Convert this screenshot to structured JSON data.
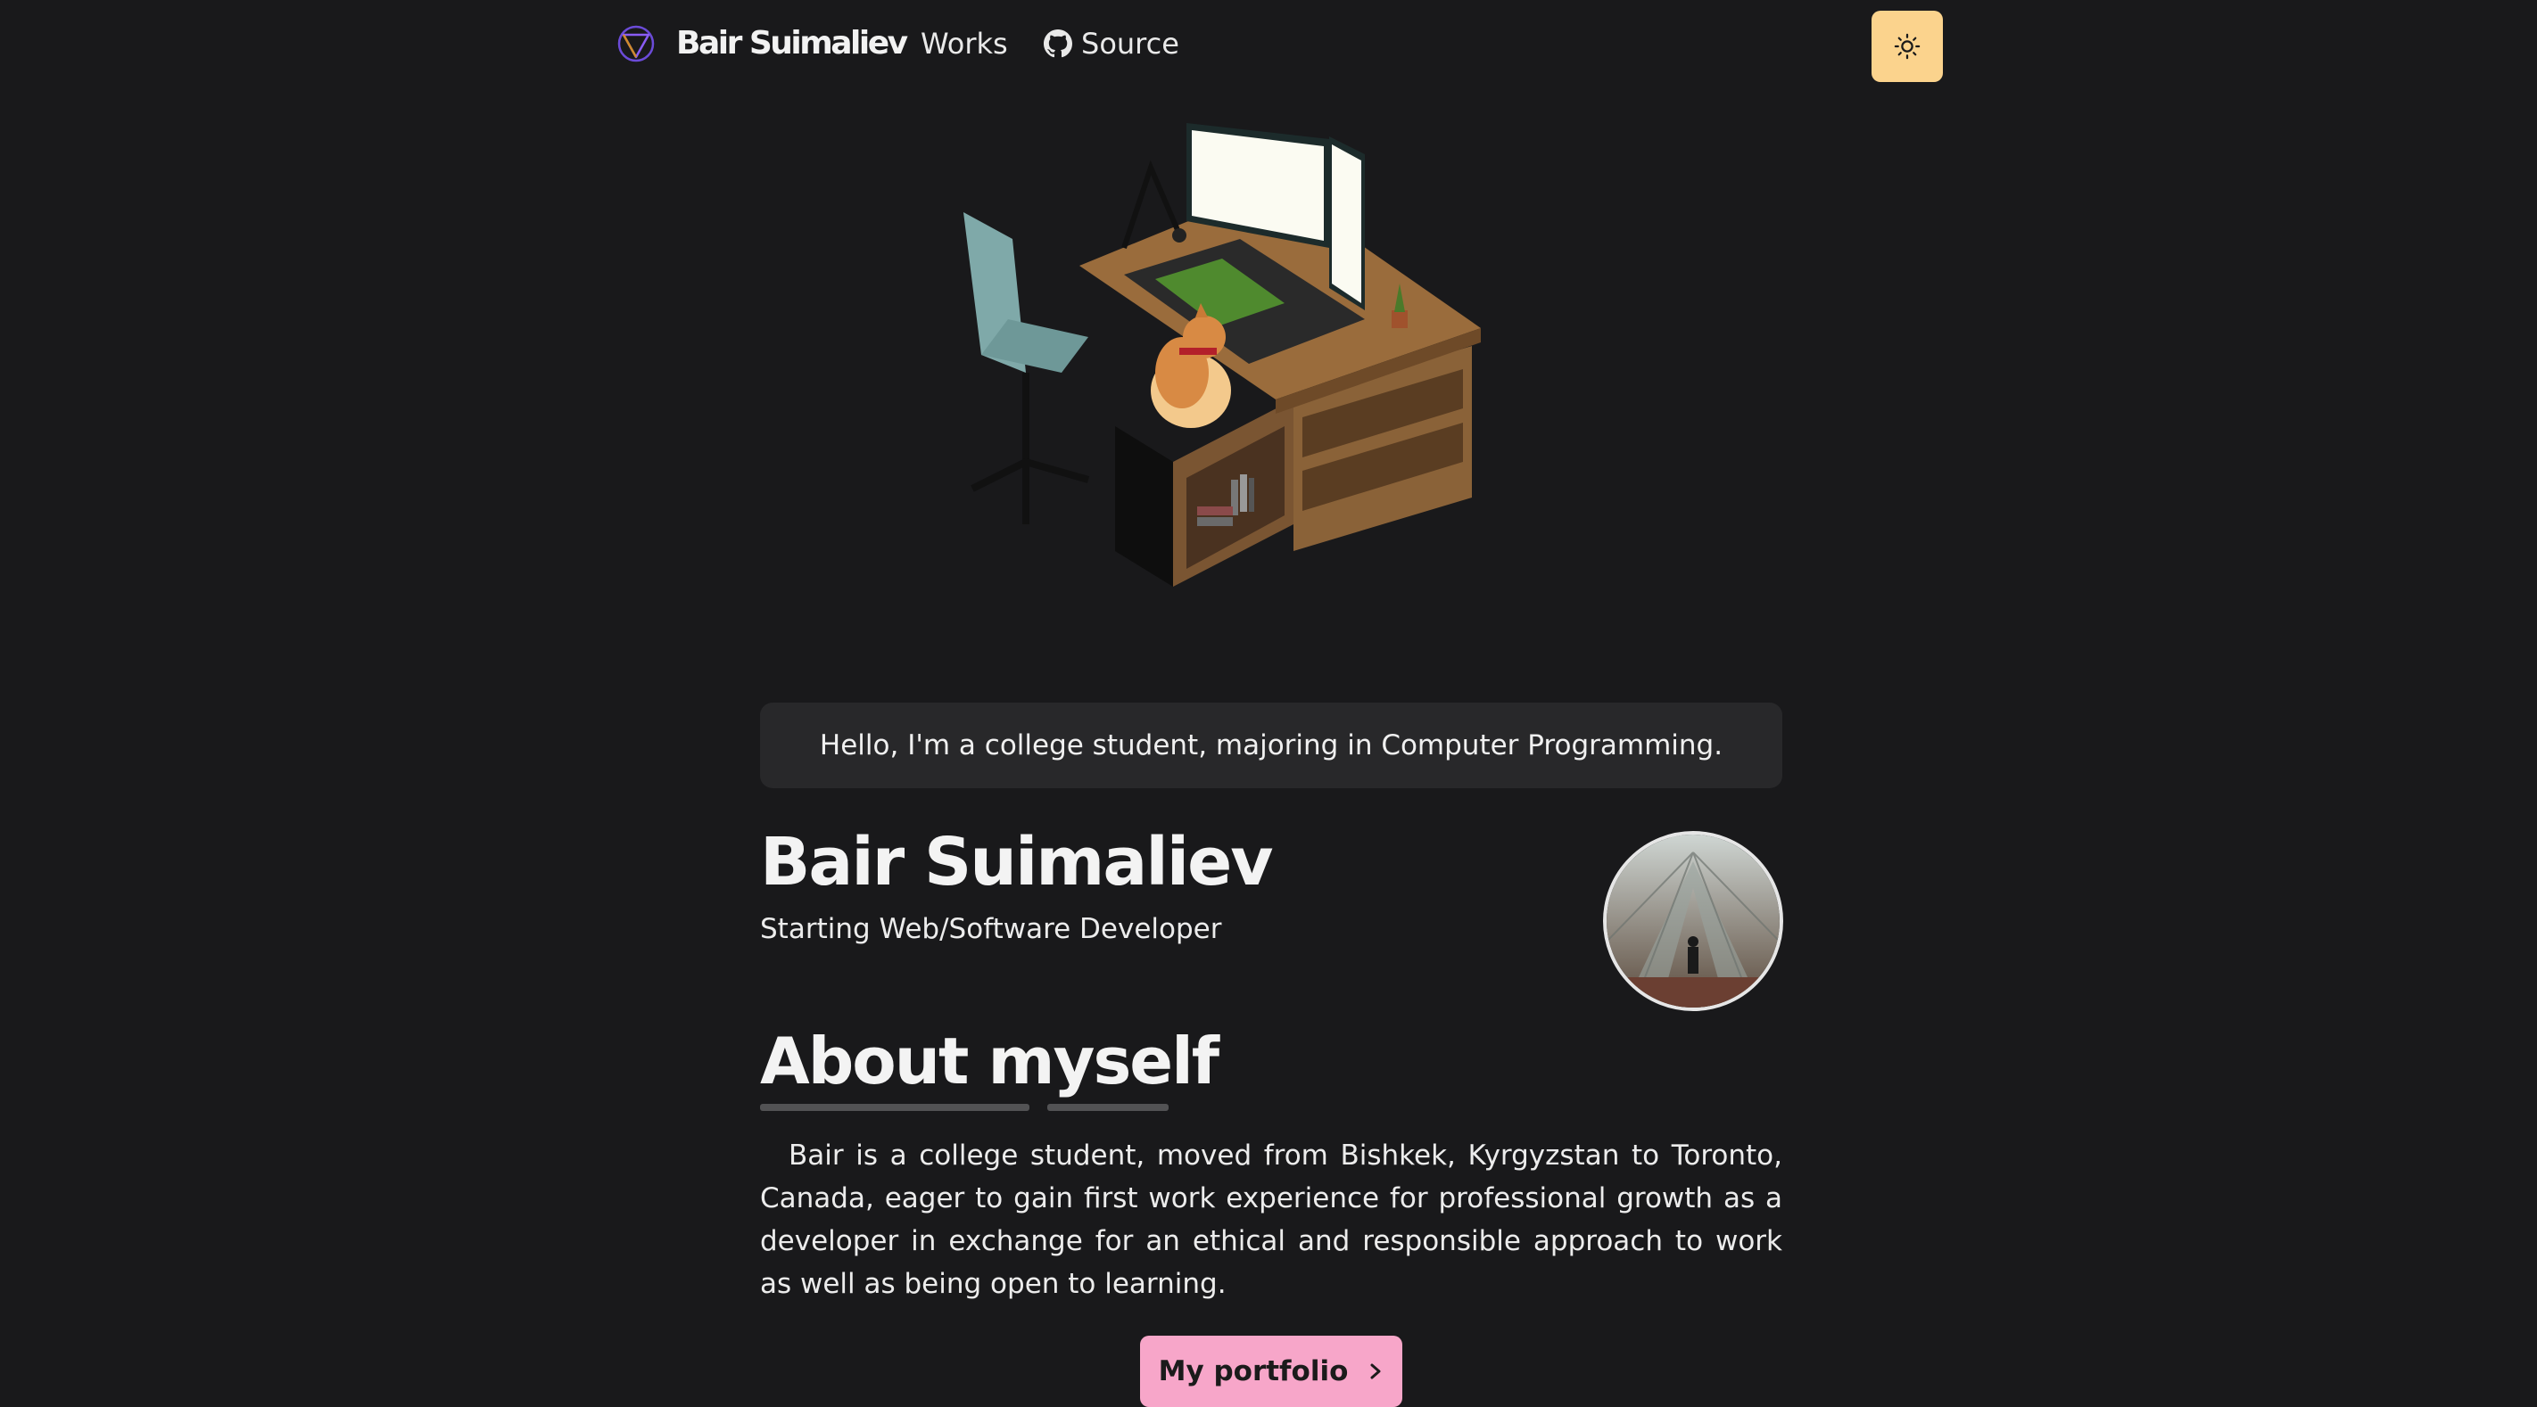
{
  "nav": {
    "brand": "Bair Suimaliev",
    "links": [
      {
        "label": "Works"
      },
      {
        "label": "Source",
        "icon": "github-icon"
      }
    ],
    "theme_toggle_icon": "sun-icon",
    "theme_toggle_color": "#fbd38d"
  },
  "hero": {
    "illustration": "3d-desk-room-with-dog-icon"
  },
  "greeting": "Hello, I'm a college student, majoring in Computer Programming.",
  "profile": {
    "name": "Bair Suimaliev",
    "role": "Starting Web/Software Developer",
    "avatar": "profile-photo"
  },
  "about": {
    "title_word1": "About",
    "title_word2": "myself",
    "body": "Bair is a college student, moved from Bishkek, Kyrgyzstan to Toronto, Canada, eager to gain first work experience for professional growth as a developer in exchange for an ethical and responsible approach to work as well as being open to learning."
  },
  "cta": {
    "label": "My portfolio",
    "icon": "chevron-right-icon",
    "color": "#f7a6c9"
  }
}
